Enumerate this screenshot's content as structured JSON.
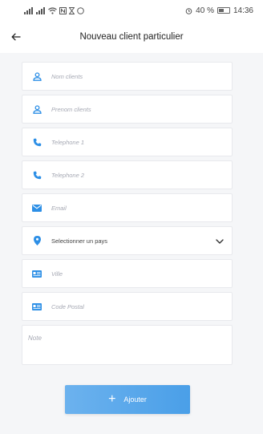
{
  "status_bar": {
    "left_icons": "signal-wifi-data-icons",
    "battery_percent": "40 %",
    "time": "14:36"
  },
  "header": {
    "title": "Nouveau client particulier"
  },
  "form": {
    "fields": [
      {
        "placeholder": "Nom clients",
        "icon": "person-icon"
      },
      {
        "placeholder": "Prenom clients",
        "icon": "person-icon"
      },
      {
        "placeholder": "Telephone 1",
        "icon": "phone-icon"
      },
      {
        "placeholder": "Telephone 2",
        "icon": "phone-icon"
      },
      {
        "placeholder": "Email",
        "icon": "mail-icon"
      }
    ],
    "country_select": {
      "label": "Selectionner un pays",
      "icon": "location-pin-icon"
    },
    "city": {
      "placeholder": "Ville",
      "icon": "id-card-icon"
    },
    "postal": {
      "placeholder": "Code Postal",
      "icon": "id-card-icon"
    },
    "note": {
      "placeholder": "Note"
    }
  },
  "actions": {
    "add_label": "Ajouter"
  },
  "colors": {
    "accent": "#2d8fe6",
    "button_start": "#6cb2ee",
    "button_end": "#4a9fe8",
    "background": "#f5f6f8"
  }
}
